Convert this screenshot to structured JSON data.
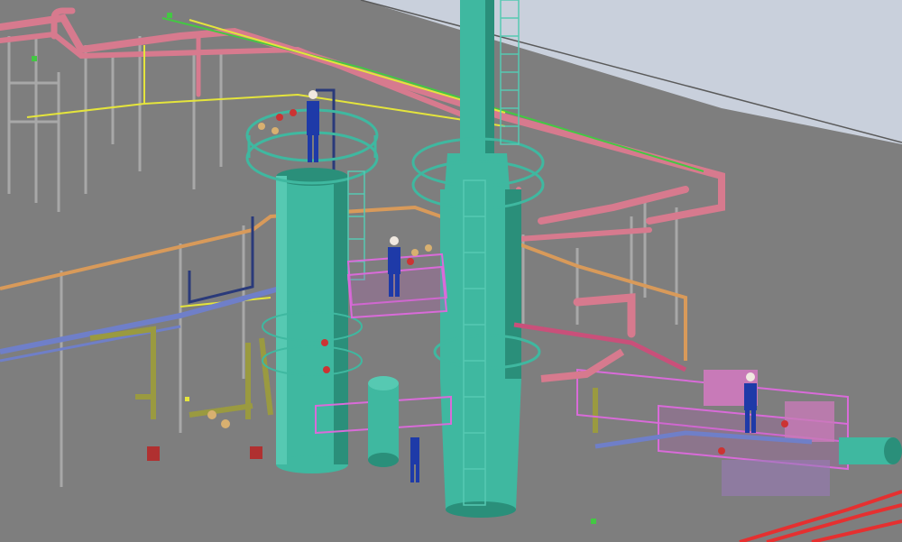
{
  "scene": {
    "description_kind": "3d-plant-model-render",
    "colors": {
      "sky": "#c9d0dc",
      "ground": "#7e7e7e",
      "equipment": "#3fb8a0",
      "equipment_dark": "#2a8f7a",
      "hot_pipe": "#d77a8e",
      "process_pipe": "#6f7fc8",
      "utility_pipe": "#d89a5a",
      "drain_pipe": "#9a9a40",
      "platform": "#d96bd9",
      "steel": "#a8a8a8",
      "marker_yellow": "#e4e43c",
      "marker_green": "#43c843",
      "red_pipe": "#e53030",
      "valve": "#cc3333",
      "worker_blue": "#1e3aa8"
    },
    "figures": 5,
    "icons": [
      "operator-figure-icon",
      "valve-icon",
      "ladder-icon"
    ]
  }
}
